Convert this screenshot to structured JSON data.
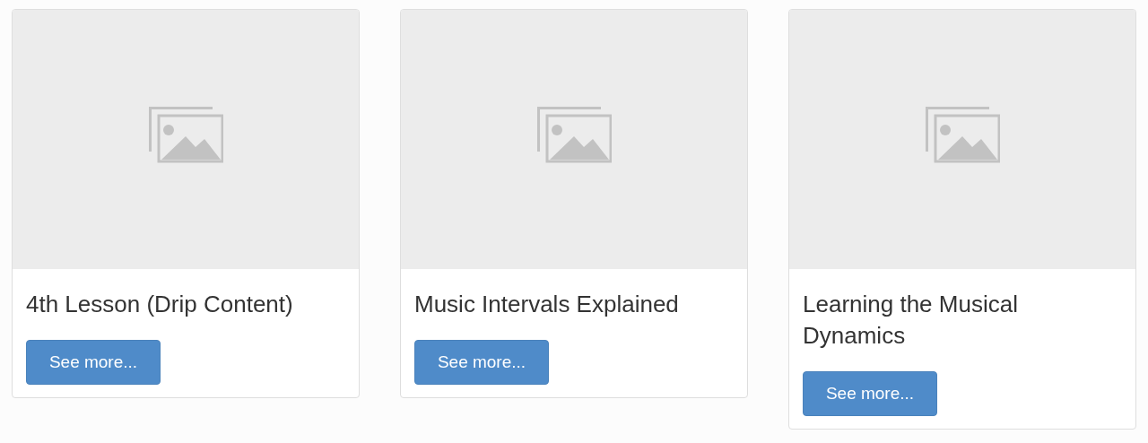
{
  "cards": [
    {
      "kind": "picture",
      "title": "4th Lesson (Drip Content)",
      "button": "See more..."
    },
    {
      "kind": "picture",
      "title": "Music Intervals Explained",
      "button": "See more..."
    },
    {
      "kind": "picture",
      "title": "Learning the Musical Dynamics",
      "button": "See more..."
    }
  ]
}
